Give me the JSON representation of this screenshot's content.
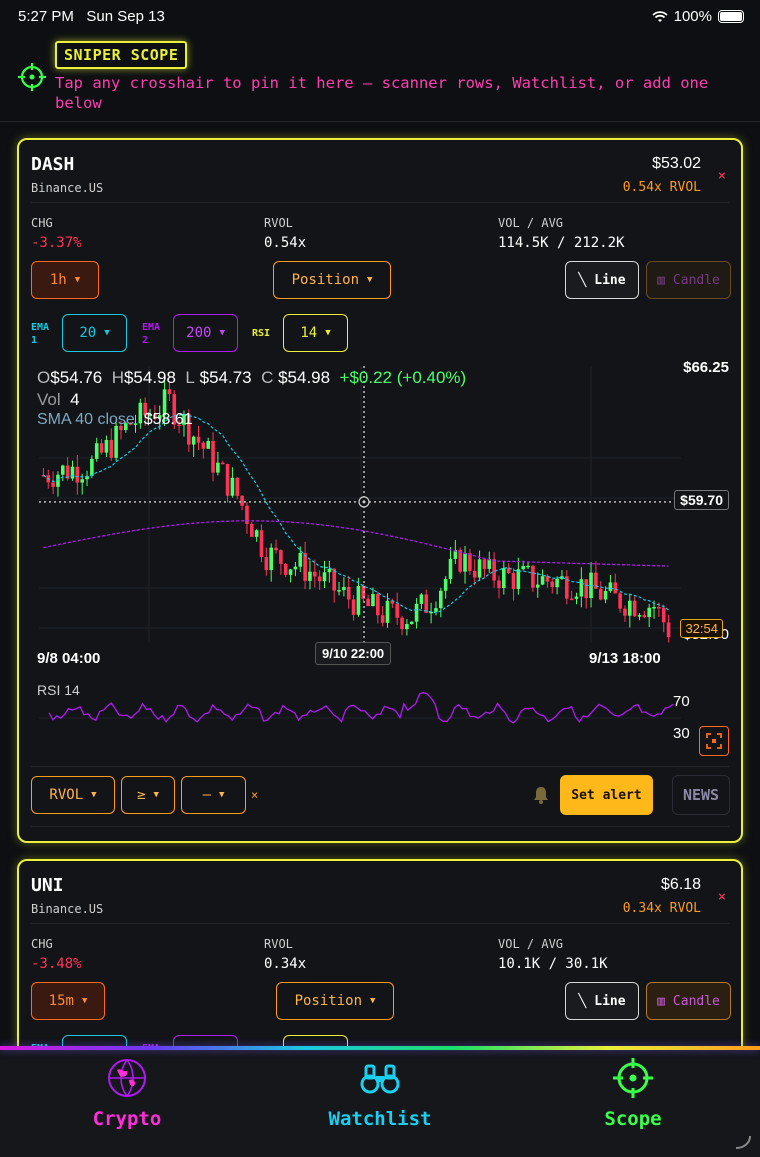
{
  "status": {
    "time": "5:27 PM",
    "date": "Sun Sep 13",
    "battery": "100%"
  },
  "scope": {
    "badge": "SNIPER SCOPE",
    "hint": "Tap any crosshair to pin it here — scanner rows, Watchlist, or add one below"
  },
  "colors": {
    "accent": "#e8f03a",
    "pink": "#ff3fb0",
    "up": "#4cff6a",
    "down": "#ff3355",
    "cyan": "#1ac9e0",
    "purple": "#b01af0",
    "amber": "#ff9c1a"
  },
  "cards": [
    {
      "symbol": "DASH",
      "exchange": "Binance.US",
      "price": "$53.02",
      "rvol_badge": "0.54x RVOL",
      "close": "×",
      "stats": [
        {
          "label": "CHG",
          "value": "-3.37%"
        },
        {
          "label": "RVOL",
          "value": "0.54x"
        },
        {
          "label": "VOL / AVG",
          "value": "114.5K / 212.2K"
        }
      ],
      "timeframe": "1h",
      "mode": "Position",
      "line_label": "Line",
      "candle_label": "Candle",
      "ema1_label": "EMA 1",
      "ema1": "20",
      "ema2_label": "EMA 2",
      "ema2": "200",
      "rsi_label": "RSI",
      "rsi": "14",
      "ohlc": {
        "o_k": "O",
        "o": "$54.76",
        "h_k": "H",
        "h": "$54.98",
        "l_k": "L",
        "l": "$54.73",
        "c_k": "C",
        "c": "$54.98",
        "delta": "+$0.22 (+0.40%)"
      },
      "vol_k": "Vol",
      "vol": "4",
      "sma_k": "SMA 40 close",
      "sma": "$58.61",
      "axis": {
        "top": "$66.25",
        "cross": "$59.70",
        "bottom": "$52.90",
        "timer": "32:54",
        "x_left": "9/8 04:00",
        "x_cross": "9/10 22:00",
        "x_right": "9/13 18:00"
      },
      "rsi_panel": {
        "label": "RSI 14",
        "high": "70",
        "low": "30"
      },
      "filter": {
        "metric": "RVOL",
        "op": "≥",
        "value": "—",
        "clear": "×"
      },
      "alert_label": "Set alert",
      "news_label": "NEWS"
    },
    {
      "symbol": "UNI",
      "exchange": "Binance.US",
      "price": "$6.18",
      "rvol_badge": "0.34x RVOL",
      "close": "×",
      "stats": [
        {
          "label": "CHG",
          "value": "-3.48%"
        },
        {
          "label": "RVOL",
          "value": "0.34x"
        },
        {
          "label": "VOL / AVG",
          "value": "10.1K / 30.1K"
        }
      ],
      "timeframe": "15m",
      "mode": "Position",
      "line_label": "Line",
      "candle_label": "Candle",
      "ema1_label": "EMA 1",
      "ema2_label": "EMA 2"
    }
  ],
  "tabs": [
    {
      "label": "Crypto",
      "color": "#ff2fd8",
      "icon": "globe-icon"
    },
    {
      "label": "Watchlist",
      "color": "#1ad0f0",
      "icon": "binoculars-icon"
    },
    {
      "label": "Scope",
      "color": "#3aff4a",
      "icon": "crosshair-icon"
    }
  ]
}
